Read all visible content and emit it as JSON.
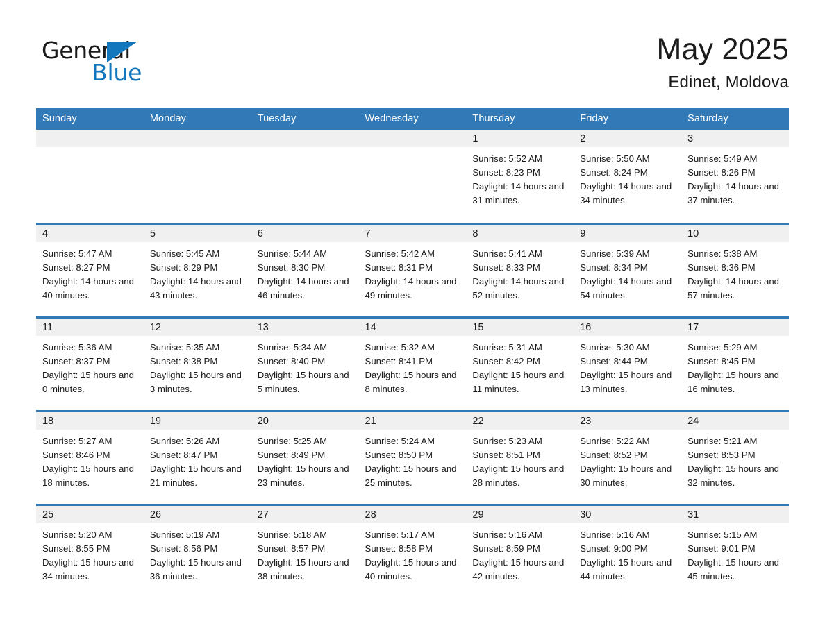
{
  "brand": {
    "name_part1": "General",
    "name_part2": "Blue",
    "triangle_icon": "triangle-icon",
    "accent_color": "#1277bc"
  },
  "header": {
    "month_title": "May 2025",
    "location": "Edinet, Moldova"
  },
  "theme": {
    "header_blue": "#3279b7",
    "daynum_band": "#f0f0f0",
    "text": "#1a1a1a"
  },
  "calendar": {
    "weekday_headers": [
      "Sunday",
      "Monday",
      "Tuesday",
      "Wednesday",
      "Thursday",
      "Friday",
      "Saturday"
    ],
    "labels": {
      "sunrise": "Sunrise:",
      "sunset": "Sunset:",
      "daylight": "Daylight:"
    },
    "weeks": [
      [
        {
          "day": "",
          "empty": true
        },
        {
          "day": "",
          "empty": true
        },
        {
          "day": "",
          "empty": true
        },
        {
          "day": "",
          "empty": true
        },
        {
          "day": "1",
          "sunrise": "Sunrise: 5:52 AM",
          "sunset": "Sunset: 8:23 PM",
          "daylight": "Daylight: 14 hours and 31 minutes."
        },
        {
          "day": "2",
          "sunrise": "Sunrise: 5:50 AM",
          "sunset": "Sunset: 8:24 PM",
          "daylight": "Daylight: 14 hours and 34 minutes."
        },
        {
          "day": "3",
          "sunrise": "Sunrise: 5:49 AM",
          "sunset": "Sunset: 8:26 PM",
          "daylight": "Daylight: 14 hours and 37 minutes."
        }
      ],
      [
        {
          "day": "4",
          "sunrise": "Sunrise: 5:47 AM",
          "sunset": "Sunset: 8:27 PM",
          "daylight": "Daylight: 14 hours and 40 minutes."
        },
        {
          "day": "5",
          "sunrise": "Sunrise: 5:45 AM",
          "sunset": "Sunset: 8:29 PM",
          "daylight": "Daylight: 14 hours and 43 minutes."
        },
        {
          "day": "6",
          "sunrise": "Sunrise: 5:44 AM",
          "sunset": "Sunset: 8:30 PM",
          "daylight": "Daylight: 14 hours and 46 minutes."
        },
        {
          "day": "7",
          "sunrise": "Sunrise: 5:42 AM",
          "sunset": "Sunset: 8:31 PM",
          "daylight": "Daylight: 14 hours and 49 minutes."
        },
        {
          "day": "8",
          "sunrise": "Sunrise: 5:41 AM",
          "sunset": "Sunset: 8:33 PM",
          "daylight": "Daylight: 14 hours and 52 minutes."
        },
        {
          "day": "9",
          "sunrise": "Sunrise: 5:39 AM",
          "sunset": "Sunset: 8:34 PM",
          "daylight": "Daylight: 14 hours and 54 minutes."
        },
        {
          "day": "10",
          "sunrise": "Sunrise: 5:38 AM",
          "sunset": "Sunset: 8:36 PM",
          "daylight": "Daylight: 14 hours and 57 minutes."
        }
      ],
      [
        {
          "day": "11",
          "sunrise": "Sunrise: 5:36 AM",
          "sunset": "Sunset: 8:37 PM",
          "daylight": "Daylight: 15 hours and 0 minutes."
        },
        {
          "day": "12",
          "sunrise": "Sunrise: 5:35 AM",
          "sunset": "Sunset: 8:38 PM",
          "daylight": "Daylight: 15 hours and 3 minutes."
        },
        {
          "day": "13",
          "sunrise": "Sunrise: 5:34 AM",
          "sunset": "Sunset: 8:40 PM",
          "daylight": "Daylight: 15 hours and 5 minutes."
        },
        {
          "day": "14",
          "sunrise": "Sunrise: 5:32 AM",
          "sunset": "Sunset: 8:41 PM",
          "daylight": "Daylight: 15 hours and 8 minutes."
        },
        {
          "day": "15",
          "sunrise": "Sunrise: 5:31 AM",
          "sunset": "Sunset: 8:42 PM",
          "daylight": "Daylight: 15 hours and 11 minutes."
        },
        {
          "day": "16",
          "sunrise": "Sunrise: 5:30 AM",
          "sunset": "Sunset: 8:44 PM",
          "daylight": "Daylight: 15 hours and 13 minutes."
        },
        {
          "day": "17",
          "sunrise": "Sunrise: 5:29 AM",
          "sunset": "Sunset: 8:45 PM",
          "daylight": "Daylight: 15 hours and 16 minutes."
        }
      ],
      [
        {
          "day": "18",
          "sunrise": "Sunrise: 5:27 AM",
          "sunset": "Sunset: 8:46 PM",
          "daylight": "Daylight: 15 hours and 18 minutes."
        },
        {
          "day": "19",
          "sunrise": "Sunrise: 5:26 AM",
          "sunset": "Sunset: 8:47 PM",
          "daylight": "Daylight: 15 hours and 21 minutes."
        },
        {
          "day": "20",
          "sunrise": "Sunrise: 5:25 AM",
          "sunset": "Sunset: 8:49 PM",
          "daylight": "Daylight: 15 hours and 23 minutes."
        },
        {
          "day": "21",
          "sunrise": "Sunrise: 5:24 AM",
          "sunset": "Sunset: 8:50 PM",
          "daylight": "Daylight: 15 hours and 25 minutes."
        },
        {
          "day": "22",
          "sunrise": "Sunrise: 5:23 AM",
          "sunset": "Sunset: 8:51 PM",
          "daylight": "Daylight: 15 hours and 28 minutes."
        },
        {
          "day": "23",
          "sunrise": "Sunrise: 5:22 AM",
          "sunset": "Sunset: 8:52 PM",
          "daylight": "Daylight: 15 hours and 30 minutes."
        },
        {
          "day": "24",
          "sunrise": "Sunrise: 5:21 AM",
          "sunset": "Sunset: 8:53 PM",
          "daylight": "Daylight: 15 hours and 32 minutes."
        }
      ],
      [
        {
          "day": "25",
          "sunrise": "Sunrise: 5:20 AM",
          "sunset": "Sunset: 8:55 PM",
          "daylight": "Daylight: 15 hours and 34 minutes."
        },
        {
          "day": "26",
          "sunrise": "Sunrise: 5:19 AM",
          "sunset": "Sunset: 8:56 PM",
          "daylight": "Daylight: 15 hours and 36 minutes."
        },
        {
          "day": "27",
          "sunrise": "Sunrise: 5:18 AM",
          "sunset": "Sunset: 8:57 PM",
          "daylight": "Daylight: 15 hours and 38 minutes."
        },
        {
          "day": "28",
          "sunrise": "Sunrise: 5:17 AM",
          "sunset": "Sunset: 8:58 PM",
          "daylight": "Daylight: 15 hours and 40 minutes."
        },
        {
          "day": "29",
          "sunrise": "Sunrise: 5:16 AM",
          "sunset": "Sunset: 8:59 PM",
          "daylight": "Daylight: 15 hours and 42 minutes."
        },
        {
          "day": "30",
          "sunrise": "Sunrise: 5:16 AM",
          "sunset": "Sunset: 9:00 PM",
          "daylight": "Daylight: 15 hours and 44 minutes."
        },
        {
          "day": "31",
          "sunrise": "Sunrise: 5:15 AM",
          "sunset": "Sunset: 9:01 PM",
          "daylight": "Daylight: 15 hours and 45 minutes."
        }
      ]
    ]
  }
}
